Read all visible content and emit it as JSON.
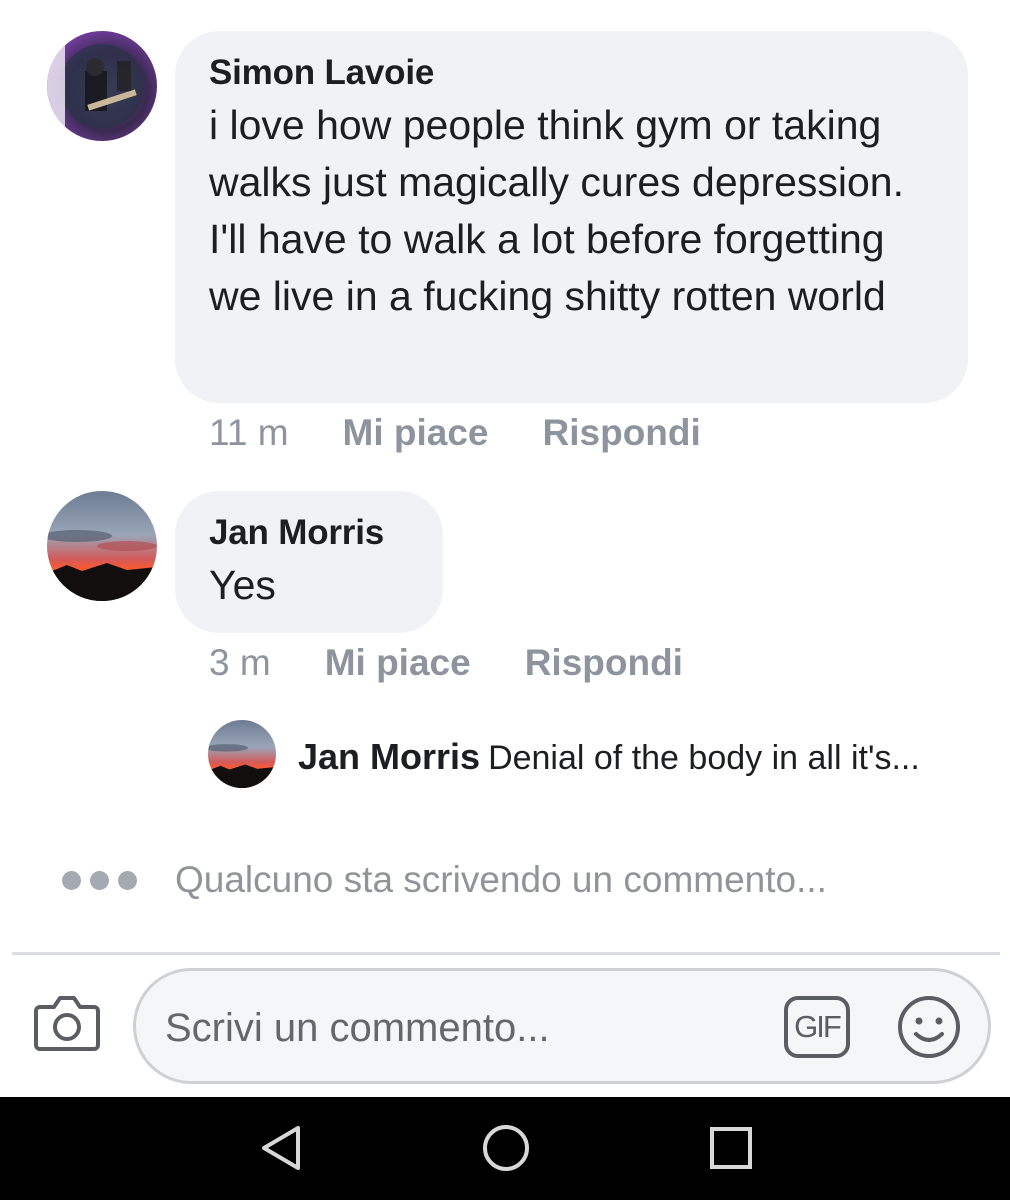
{
  "comments": [
    {
      "author": "Simon Lavoie",
      "text": "i love how people think gym or taking walks just magically cures depression. I'll have to walk a lot before forgetting we live in a fucking shitty rotten world",
      "time": "11 m",
      "like_label": "Mi piace",
      "reply_label": "Rispondi"
    },
    {
      "author": "Jan Morris",
      "text": "Yes",
      "time": "3 m",
      "like_label": "Mi piace",
      "reply_label": "Rispondi"
    }
  ],
  "reply_preview": {
    "author": "Jan Morris",
    "text": "Denial of the body in all it's..."
  },
  "typing_indicator": "Qualcuno sta scrivendo un commento...",
  "composer": {
    "placeholder": "Scrivi un commento...",
    "gif_label": "GIF"
  },
  "icons": {
    "camera": "camera-icon",
    "gif": "gif-icon",
    "emoji": "smiley-icon",
    "back": "back-triangle-icon",
    "home": "home-circle-icon",
    "recents": "recents-square-icon"
  },
  "colors": {
    "bubble_bg": "#f0f2f5",
    "meta_gray": "#8d949e",
    "text": "#1c1e21",
    "nav_bg": "#000000"
  }
}
